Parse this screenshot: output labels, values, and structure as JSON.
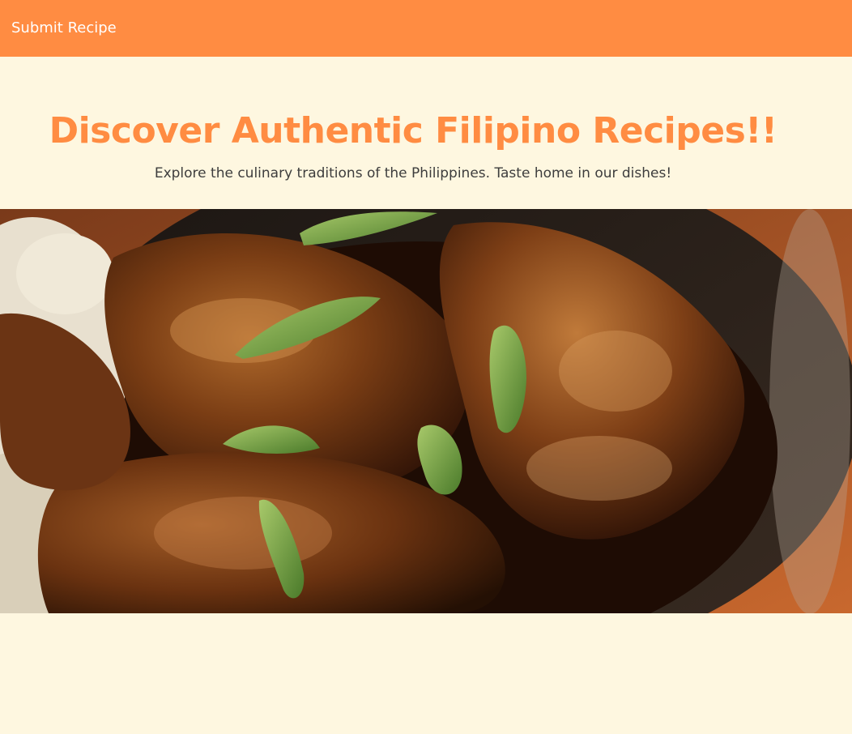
{
  "navbar": {
    "link_label": "Submit Recipe",
    "background_color": "#ff8c42"
  },
  "hero": {
    "title": "Discover Authentic Filipino Recipes!!",
    "subtitle": "Explore the culinary traditions of the Philippines. Taste home in our dishes!",
    "title_color": "#ff8c42"
  },
  "image": {
    "alt": "Chicken adobo with green onions and rice"
  },
  "colors": {
    "page_background": "#fef7e0",
    "accent": "#ff8c42"
  }
}
